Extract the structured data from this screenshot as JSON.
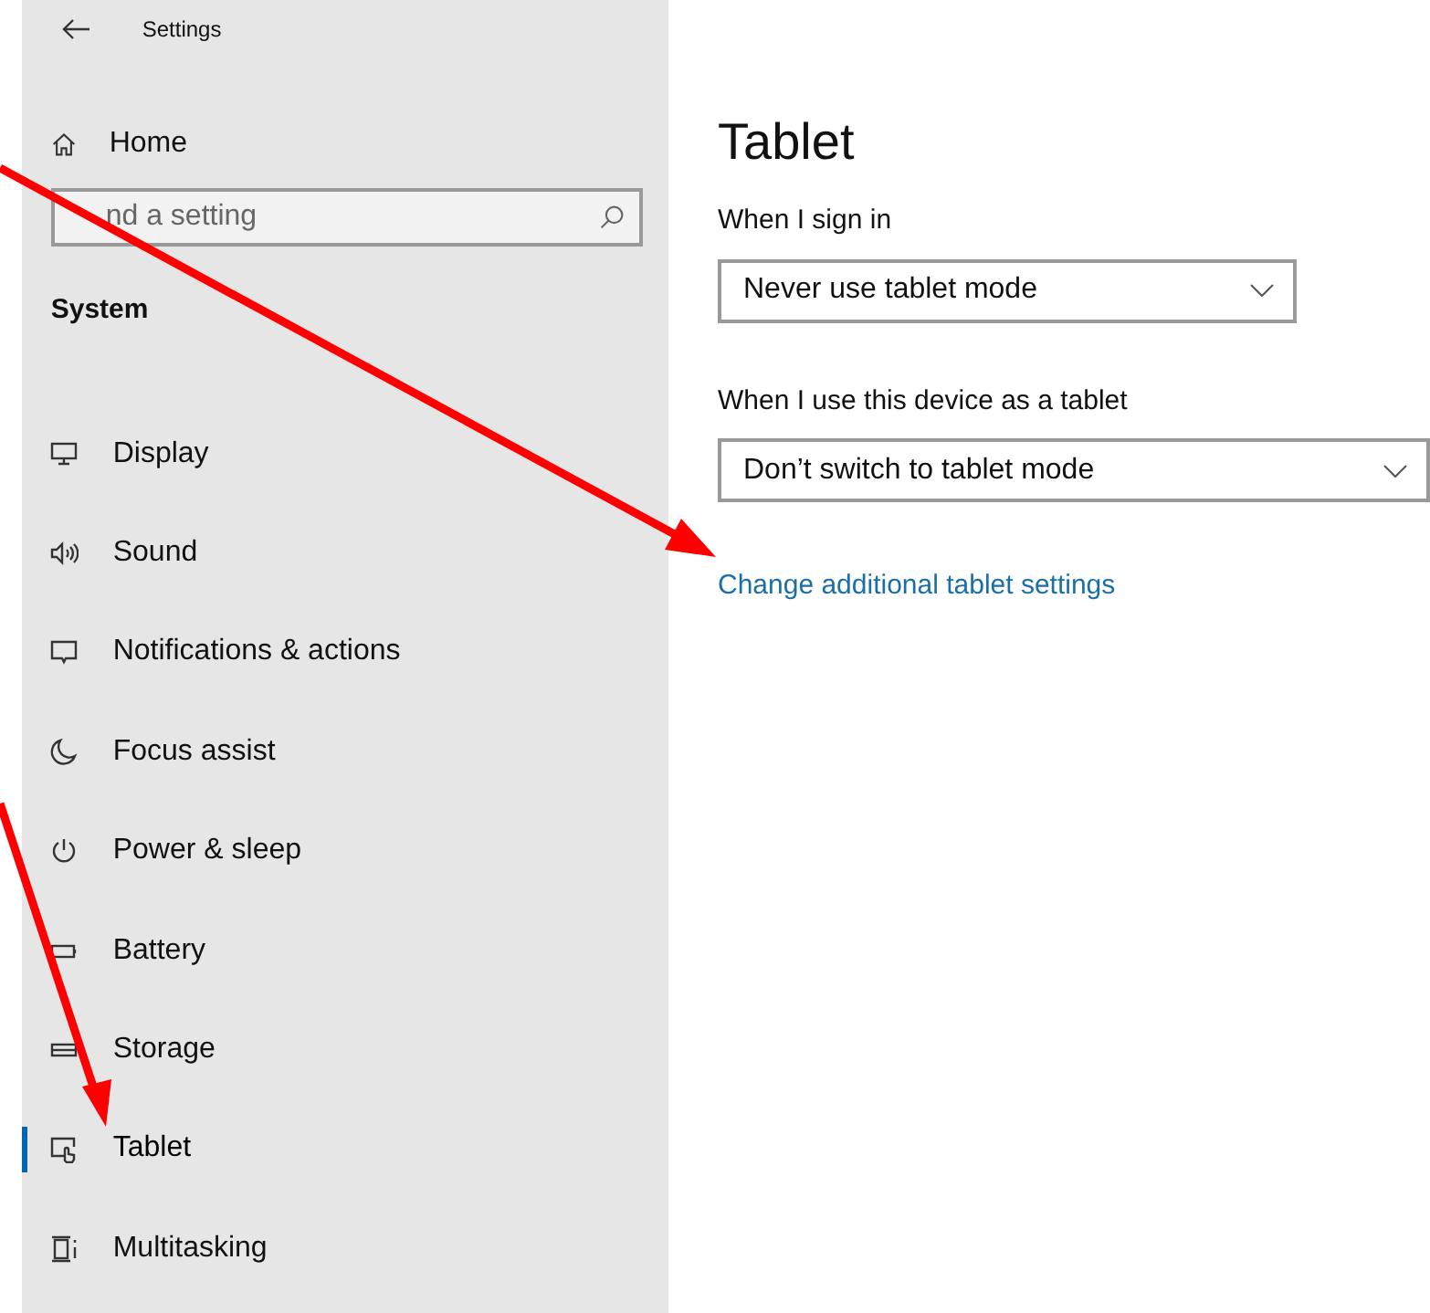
{
  "window": {
    "title": "Settings"
  },
  "sidebar": {
    "home": "Home",
    "search": {
      "placeholder": "nd a setting"
    },
    "section": "System",
    "items": [
      {
        "label": "Display",
        "selected": false
      },
      {
        "label": "Sound",
        "selected": false
      },
      {
        "label": "Notifications & actions",
        "selected": false
      },
      {
        "label": "Focus assist",
        "selected": false
      },
      {
        "label": "Power & sleep",
        "selected": false
      },
      {
        "label": "Battery",
        "selected": false
      },
      {
        "label": "Storage",
        "selected": false
      },
      {
        "label": "Tablet",
        "selected": true
      },
      {
        "label": "Multitasking",
        "selected": false
      }
    ]
  },
  "content": {
    "title": "Tablet",
    "settings": [
      {
        "label": "When I sign in",
        "value": "Never use tablet mode",
        "wide": false
      },
      {
        "label": "When I use this device as a tablet",
        "value": "Don’t switch to tablet mode",
        "wide": true
      }
    ],
    "link": "Change additional tablet settings"
  }
}
